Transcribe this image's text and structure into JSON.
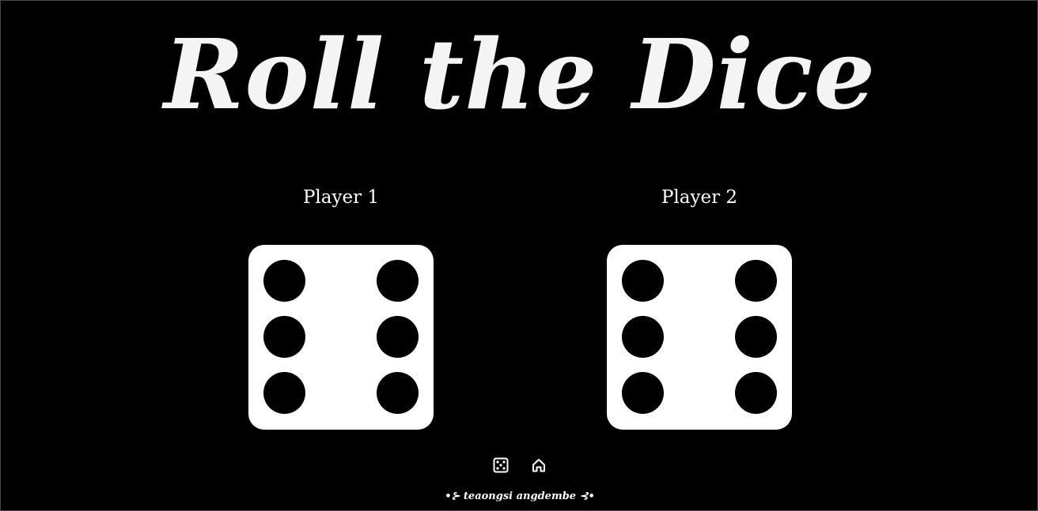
{
  "app": {
    "title": "Roll the Dice"
  },
  "players": [
    {
      "label": "Player 1",
      "die_value": 6
    },
    {
      "label": "Player 2",
      "die_value": 6
    }
  ],
  "toolbar": {
    "roll_icon": "dice-icon",
    "home_icon": "home-icon"
  },
  "footer": {
    "credit": "•⊱ teaongsi angdembe ⊰•"
  },
  "colors": {
    "background": "#000000",
    "foreground": "#ffffff"
  }
}
